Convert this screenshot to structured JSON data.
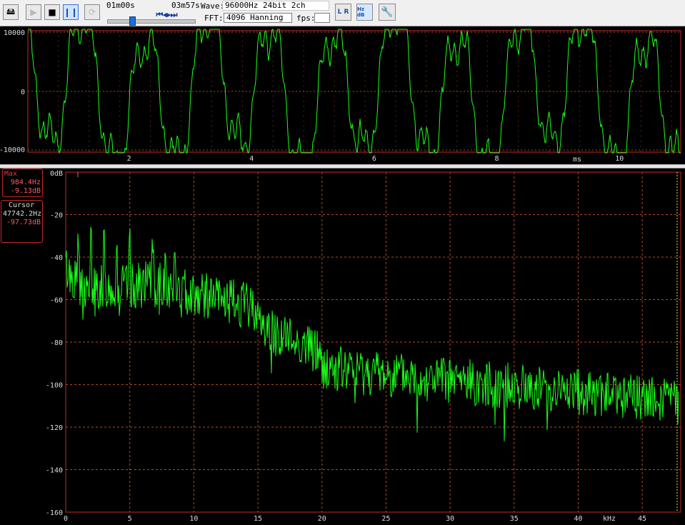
{
  "toolbar": {
    "position_time": "01m00s",
    "total_time": "03m57s",
    "wave_label": "Wave:",
    "wave_value": "96000Hz 24bit 2ch",
    "fft_label": "FFT:",
    "fft_value": "4096 Hanning",
    "fps_label": "fps:",
    "fps_value": "",
    "lr_icon_text": "L R",
    "hz_db_icon_text": "Hz dB",
    "seek_progress": 0.27
  },
  "waveform": {
    "y_ticks": [
      "10000",
      "0",
      "-10000"
    ],
    "x_ticks": [
      "2",
      "4",
      "6",
      "8",
      "10"
    ],
    "x_unit": "ms"
  },
  "spectrum": {
    "y_ticks": [
      "0dB",
      "-20",
      "-40",
      "-60",
      "-80",
      "-100",
      "-120",
      "-140",
      "-160"
    ],
    "x_ticks": [
      "0",
      "5",
      "10",
      "15",
      "20",
      "25",
      "30",
      "35",
      "40",
      "45"
    ],
    "x_unit": "kHz",
    "max_box": {
      "title": "Max",
      "freq": "984.4Hz",
      "level": "-9.13dB"
    },
    "cursor_box": {
      "title": "Cursor",
      "freq": "47742.2Hz",
      "level": "-97.73dB"
    }
  },
  "colors": {
    "trace": "#1aff1a",
    "frame": "#c62a2a",
    "grid": "#b24a22",
    "toolbar_bg": "#f0f0f0",
    "cursor_line": "#e8e85a"
  }
}
